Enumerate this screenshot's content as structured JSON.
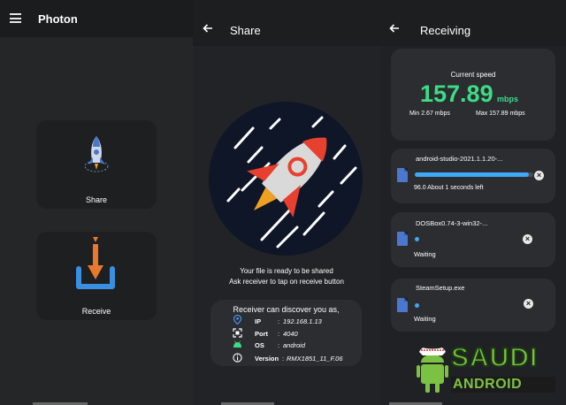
{
  "left": {
    "title": "Photon",
    "share_label": "Share",
    "receive_label": "Receive"
  },
  "middle": {
    "title": "Share",
    "ready_line1": "Your file is ready to be shared",
    "ready_line2": "Ask receiver to tap on receive button",
    "discover_title": "Receiver can discover you as,",
    "info": [
      {
        "icon": "location-icon",
        "key": "IP",
        "value": "192.168.1.13"
      },
      {
        "icon": "port-icon",
        "key": "Port",
        "value": "4040"
      },
      {
        "icon": "android-icon",
        "key": "OS",
        "value": "android"
      },
      {
        "icon": "info-icon",
        "key": "Version",
        "value": "RMX1851_11_F.06"
      }
    ],
    "separator": ":"
  },
  "right": {
    "title": "Receiving",
    "speed_label": "Current speed",
    "speed_value": "157.89",
    "speed_unit": "mbps",
    "min_label": "Min 2.67 mbps",
    "max_label": "Max 157.89  mbps",
    "files": [
      {
        "name": "android-studio-2021.1.1.20-...",
        "status": "96.0   About 1 seconds left",
        "progress": 0.96
      },
      {
        "name": "DOSBox0.74-3-win32-...",
        "status": "Waiting"
      },
      {
        "name": "SteamSetup.exe",
        "status": "Waiting"
      }
    ]
  },
  "watermark": {
    "line1": "SAUDI",
    "line2": "ANDROID"
  },
  "colors": {
    "accent_green": "#3ddc84",
    "progress_blue": "#3fa9f5",
    "rocket_red": "#e8402e",
    "circle_bg": "#0e1628"
  }
}
